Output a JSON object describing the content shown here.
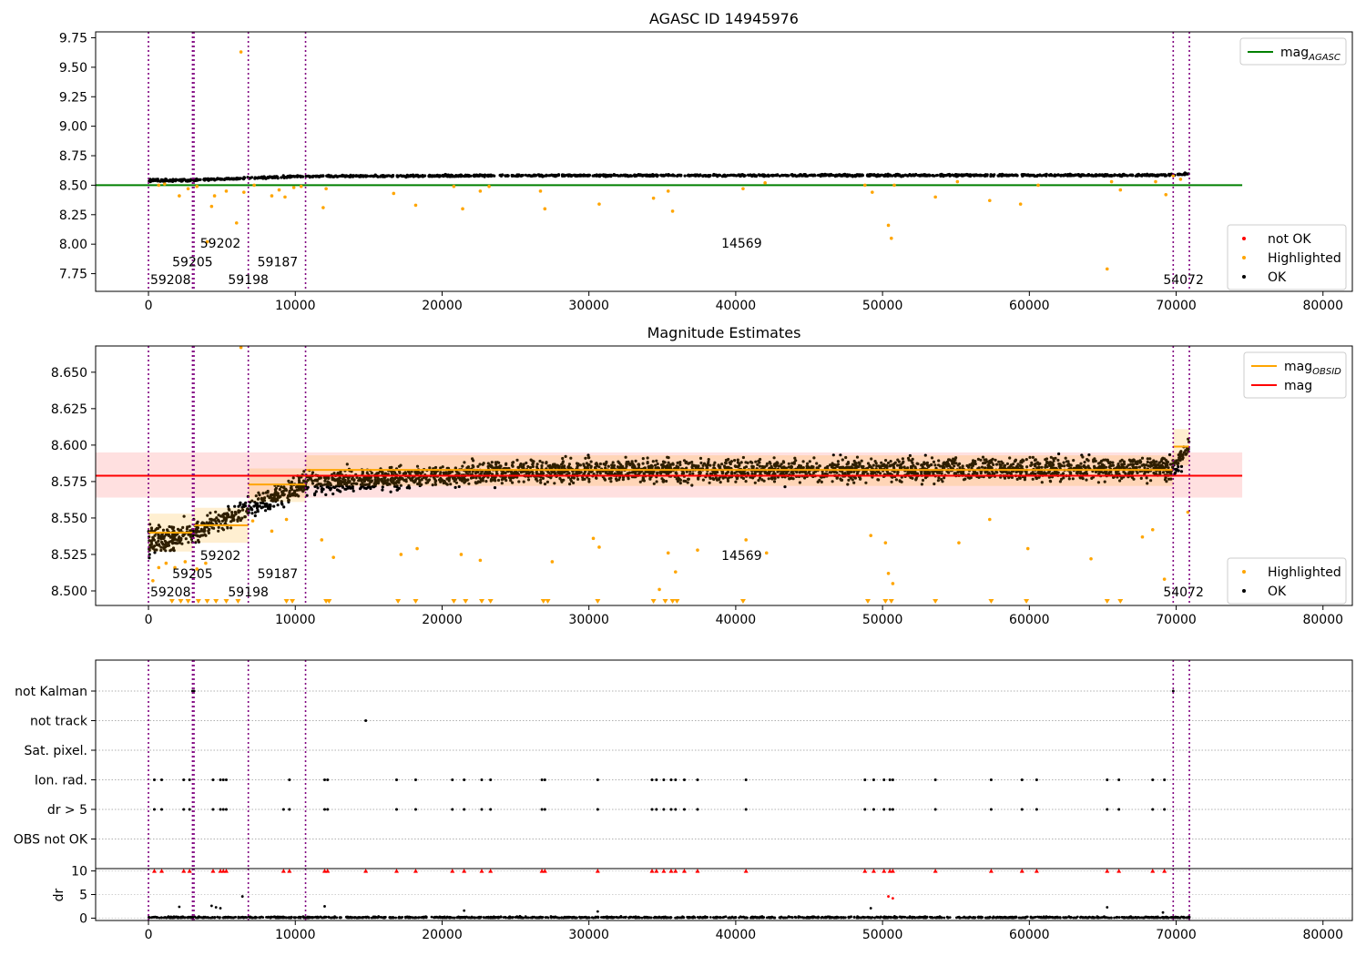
{
  "chart_data": [
    {
      "type": "scatter",
      "title": "AGASC ID 14945976",
      "xlim": [
        -3600,
        82000
      ],
      "ylim": [
        7.6,
        9.8
      ],
      "xticks": [
        0,
        10000,
        20000,
        30000,
        40000,
        50000,
        60000,
        70000,
        80000
      ],
      "yticks": [
        7.75,
        8.0,
        8.25,
        8.5,
        8.75,
        9.0,
        9.25,
        9.5,
        9.75
      ],
      "ytick_labels": [
        "7.75",
        "8.00",
        "8.25",
        "8.50",
        "8.75",
        "9.00",
        "9.25",
        "9.50",
        "9.75"
      ],
      "obsid_lines": [
        0,
        3000,
        3100,
        6800,
        10700,
        69800,
        70900
      ],
      "obsid_labels": [
        {
          "text": "59208",
          "x": 1500,
          "y": 7.7
        },
        {
          "text": "59205",
          "x": 3000,
          "y": 7.85
        },
        {
          "text": "59202",
          "x": 4900,
          "y": 8.01
        },
        {
          "text": "59198",
          "x": 6800,
          "y": 7.7
        },
        {
          "text": "59187",
          "x": 8800,
          "y": 7.85
        },
        {
          "text": "14569",
          "x": 40400,
          "y": 8.01
        },
        {
          "text": "54072",
          "x": 70500,
          "y": 7.7
        }
      ],
      "reference_line": {
        "label": "mag",
        "subscript": "AGASC",
        "y": 8.5,
        "x_range": [
          -3600,
          74500
        ]
      },
      "trend": [
        [
          0,
          8.54
        ],
        [
          3000,
          8.544
        ],
        [
          6800,
          8.56
        ],
        [
          10700,
          8.576
        ],
        [
          25000,
          8.582
        ],
        [
          69800,
          8.585
        ],
        [
          70900,
          8.598
        ]
      ],
      "highlighted": [
        [
          700,
          8.5
        ],
        [
          1100,
          8.51
        ],
        [
          2100,
          8.41
        ],
        [
          2700,
          8.47
        ],
        [
          3300,
          8.49
        ],
        [
          4000,
          8.02
        ],
        [
          4300,
          8.32
        ],
        [
          4500,
          8.41
        ],
        [
          5300,
          8.45
        ],
        [
          6000,
          8.18
        ],
        [
          6300,
          9.63
        ],
        [
          6500,
          8.44
        ],
        [
          7200,
          8.5
        ],
        [
          8400,
          8.41
        ],
        [
          8900,
          8.46
        ],
        [
          9300,
          8.4
        ],
        [
          9900,
          8.48
        ],
        [
          10400,
          8.49
        ],
        [
          11900,
          8.31
        ],
        [
          12100,
          8.47
        ],
        [
          16700,
          8.43
        ],
        [
          18200,
          8.33
        ],
        [
          20800,
          8.49
        ],
        [
          21400,
          8.3
        ],
        [
          22600,
          8.45
        ],
        [
          23200,
          8.49
        ],
        [
          26700,
          8.45
        ],
        [
          27000,
          8.3
        ],
        [
          30700,
          8.34
        ],
        [
          34400,
          8.39
        ],
        [
          35400,
          8.45
        ],
        [
          35700,
          8.28
        ],
        [
          40500,
          8.47
        ],
        [
          42000,
          8.52
        ],
        [
          48800,
          8.5
        ],
        [
          49300,
          8.44
        ],
        [
          50400,
          8.16
        ],
        [
          50600,
          8.05
        ],
        [
          50800,
          8.5
        ],
        [
          53600,
          8.4
        ],
        [
          55100,
          8.53
        ],
        [
          57300,
          8.37
        ],
        [
          59400,
          8.34
        ],
        [
          60600,
          8.5
        ],
        [
          65300,
          7.79
        ],
        [
          65600,
          8.53
        ],
        [
          66200,
          8.46
        ],
        [
          68600,
          8.53
        ],
        [
          69300,
          8.42
        ],
        [
          69800,
          8.58
        ],
        [
          70300,
          8.55
        ]
      ],
      "not_ok": [],
      "legend": [
        {
          "label": "mag",
          "subscript": "AGASC",
          "color": "#008000",
          "kind": "line"
        },
        {
          "label": "not OK",
          "color": "#ff0000",
          "kind": "dot"
        },
        {
          "label": "Highlighted",
          "color": "#ffa500",
          "kind": "dot"
        },
        {
          "label": "OK",
          "color": "#000000",
          "kind": "dot"
        }
      ]
    },
    {
      "type": "scatter",
      "title": "Magnitude Estimates",
      "xlim": [
        -3600,
        82000
      ],
      "ylim": [
        8.49,
        8.668
      ],
      "xticks": [
        0,
        10000,
        20000,
        30000,
        40000,
        50000,
        60000,
        70000,
        80000
      ],
      "yticks": [
        8.5,
        8.525,
        8.55,
        8.575,
        8.6,
        8.625,
        8.65
      ],
      "ytick_labels": [
        "8.500",
        "8.525",
        "8.550",
        "8.575",
        "8.600",
        "8.625",
        "8.650"
      ],
      "obsid_lines": [
        0,
        3000,
        3100,
        6800,
        10700,
        69800,
        70900
      ],
      "obsid_labels": [
        {
          "text": "59208",
          "x": 1500,
          "y": 8.4995
        },
        {
          "text": "59205",
          "x": 3000,
          "y": 8.512
        },
        {
          "text": "59202",
          "x": 4900,
          "y": 8.5245
        },
        {
          "text": "59198",
          "x": 6800,
          "y": 8.4995
        },
        {
          "text": "59187",
          "x": 8800,
          "y": 8.512
        },
        {
          "text": "14569",
          "x": 40400,
          "y": 8.5245
        },
        {
          "text": "54072",
          "x": 70500,
          "y": 8.4995
        }
      ],
      "mag_line": {
        "y": 8.579,
        "band": [
          8.564,
          8.595
        ],
        "x_range": [
          -3600,
          74500
        ]
      },
      "obsid_segments": [
        {
          "x": [
            0,
            3000
          ],
          "mag": 8.54,
          "band": [
            8.527,
            8.553
          ]
        },
        {
          "x": [
            3100,
            6800
          ],
          "mag": 8.545,
          "band": [
            8.533,
            8.557
          ]
        },
        {
          "x": [
            6800,
            10700
          ],
          "mag": 8.573,
          "band": [
            8.561,
            8.584
          ]
        },
        {
          "x": [
            10700,
            69800
          ],
          "mag": 8.583,
          "band": [
            8.572,
            8.593
          ]
        },
        {
          "x": [
            69800,
            70900
          ],
          "mag": 8.599,
          "band": [
            8.586,
            8.611
          ]
        }
      ],
      "trend": [
        [
          0,
          8.534
        ],
        [
          3000,
          8.54
        ],
        [
          6800,
          8.556
        ],
        [
          10700,
          8.574
        ],
        [
          25000,
          8.582
        ],
        [
          69800,
          8.584
        ],
        [
          70900,
          8.599
        ]
      ],
      "highlighted": [
        [
          300,
          8.507
        ],
        [
          700,
          8.516
        ],
        [
          1200,
          8.519
        ],
        [
          1800,
          8.516
        ],
        [
          2500,
          8.52
        ],
        [
          3300,
          8.515
        ],
        [
          3900,
          8.519
        ],
        [
          6300,
          8.667
        ],
        [
          7100,
          8.548
        ],
        [
          8400,
          8.541
        ],
        [
          9400,
          8.549
        ],
        [
          11800,
          8.535
        ],
        [
          12600,
          8.523
        ],
        [
          17200,
          8.525
        ],
        [
          18300,
          8.529
        ],
        [
          21300,
          8.525
        ],
        [
          22600,
          8.521
        ],
        [
          27500,
          8.52
        ],
        [
          30300,
          8.536
        ],
        [
          30700,
          8.53
        ],
        [
          34800,
          8.501
        ],
        [
          35400,
          8.526
        ],
        [
          35900,
          8.513
        ],
        [
          37400,
          8.528
        ],
        [
          40700,
          8.535
        ],
        [
          42100,
          8.526
        ],
        [
          49200,
          8.538
        ],
        [
          50200,
          8.533
        ],
        [
          50400,
          8.512
        ],
        [
          50700,
          8.505
        ],
        [
          55200,
          8.533
        ],
        [
          57300,
          8.549
        ],
        [
          59900,
          8.529
        ],
        [
          64200,
          8.522
        ],
        [
          67700,
          8.537
        ],
        [
          68400,
          8.542
        ],
        [
          69200,
          8.508
        ],
        [
          70800,
          8.554
        ]
      ],
      "low_markers": [
        1600,
        2200,
        2700,
        3400,
        4000,
        4600,
        5300,
        6100,
        9400,
        9800,
        12100,
        12300,
        17000,
        18200,
        20800,
        21600,
        22700,
        23300,
        26900,
        27200,
        30600,
        34400,
        35200,
        35700,
        36000,
        40500,
        49000,
        50200,
        50600,
        53600,
        57400,
        59800,
        65300,
        66200
      ],
      "legend": [
        {
          "label": "mag",
          "subscript": "OBSID",
          "color": "#ffa500",
          "kind": "line"
        },
        {
          "label": "mag",
          "color": "#ff0000",
          "kind": "line"
        },
        {
          "label": "Highlighted",
          "color": "#ffa500",
          "kind": "dot"
        },
        {
          "label": "OK",
          "color": "#000000",
          "kind": "dot"
        }
      ]
    },
    {
      "type": "scatter",
      "title": "",
      "xlim": [
        -3600,
        82000
      ],
      "categories": [
        "not Kalman",
        "not track",
        "Sat. pixel.",
        "Ion. rad.",
        "dr > 5",
        "OBS not OK"
      ],
      "obsid_lines": [
        0,
        3000,
        3100,
        6800,
        10700,
        69800,
        70900
      ],
      "flags": {
        "not Kalman": [
          3000,
          3100,
          69800
        ],
        "not track": [
          14800
        ],
        "Sat. pixel.": [],
        "Ion. rad.": [
          400,
          900,
          2400,
          2800,
          4400,
          4900,
          5100,
          5300,
          9600,
          12000,
          12200,
          16900,
          18200,
          20700,
          21500,
          22700,
          23300,
          26800,
          27000,
          30600,
          34300,
          34600,
          35100,
          35600,
          35900,
          36500,
          37400,
          40700,
          48800,
          49400,
          50100,
          50500,
          50700,
          53600,
          57400,
          59500,
          60500,
          65300,
          66100,
          68400,
          69200
        ],
        "dr > 5": [
          400,
          900,
          2400,
          2800,
          4400,
          4900,
          5100,
          5300,
          9200,
          9600,
          12000,
          12200,
          16900,
          18200,
          20700,
          21500,
          22700,
          23300,
          26800,
          27000,
          30600,
          34300,
          34600,
          35100,
          35600,
          35900,
          36500,
          37400,
          40700,
          48800,
          49400,
          50100,
          50500,
          50700,
          53600,
          57400,
          59500,
          60500,
          65300,
          66100,
          68400,
          69200
        ],
        "OBS not OK": []
      }
    },
    {
      "type": "scatter",
      "title": "",
      "ylabel": "dr",
      "xlim": [
        -3600,
        82000
      ],
      "ylim": [
        -0.5,
        10.5
      ],
      "xticks": [
        0,
        10000,
        20000,
        30000,
        40000,
        50000,
        60000,
        70000,
        80000
      ],
      "yticks": [
        0,
        5,
        10
      ],
      "ytick_labels": [
        "0",
        "5",
        "10"
      ],
      "obsid_lines": [
        0,
        3000,
        3100,
        6800,
        10700,
        69800,
        70900
      ],
      "clipped_markers": [
        400,
        900,
        2400,
        2800,
        4400,
        4900,
        5100,
        5300,
        9200,
        9600,
        12000,
        12200,
        14800,
        16900,
        18200,
        20700,
        21500,
        22700,
        23300,
        26800,
        27000,
        30600,
        34300,
        34600,
        35100,
        35600,
        35900,
        36500,
        37400,
        40700,
        48800,
        49400,
        50100,
        50500,
        50700,
        53600,
        57400,
        59500,
        60500,
        65300,
        66100,
        68400,
        69200
      ],
      "outliers": [
        [
          2100,
          2.4
        ],
        [
          4300,
          2.6
        ],
        [
          4600,
          2.3
        ],
        [
          4900,
          2.1
        ],
        [
          6400,
          4.6
        ],
        [
          12000,
          2.5
        ],
        [
          21500,
          1.6
        ],
        [
          30600,
          1.4
        ],
        [
          49200,
          2.1
        ],
        [
          50400,
          4.6
        ],
        [
          50700,
          4.2
        ],
        [
          65300,
          2.3
        ],
        [
          69100,
          1.2
        ]
      ]
    }
  ]
}
